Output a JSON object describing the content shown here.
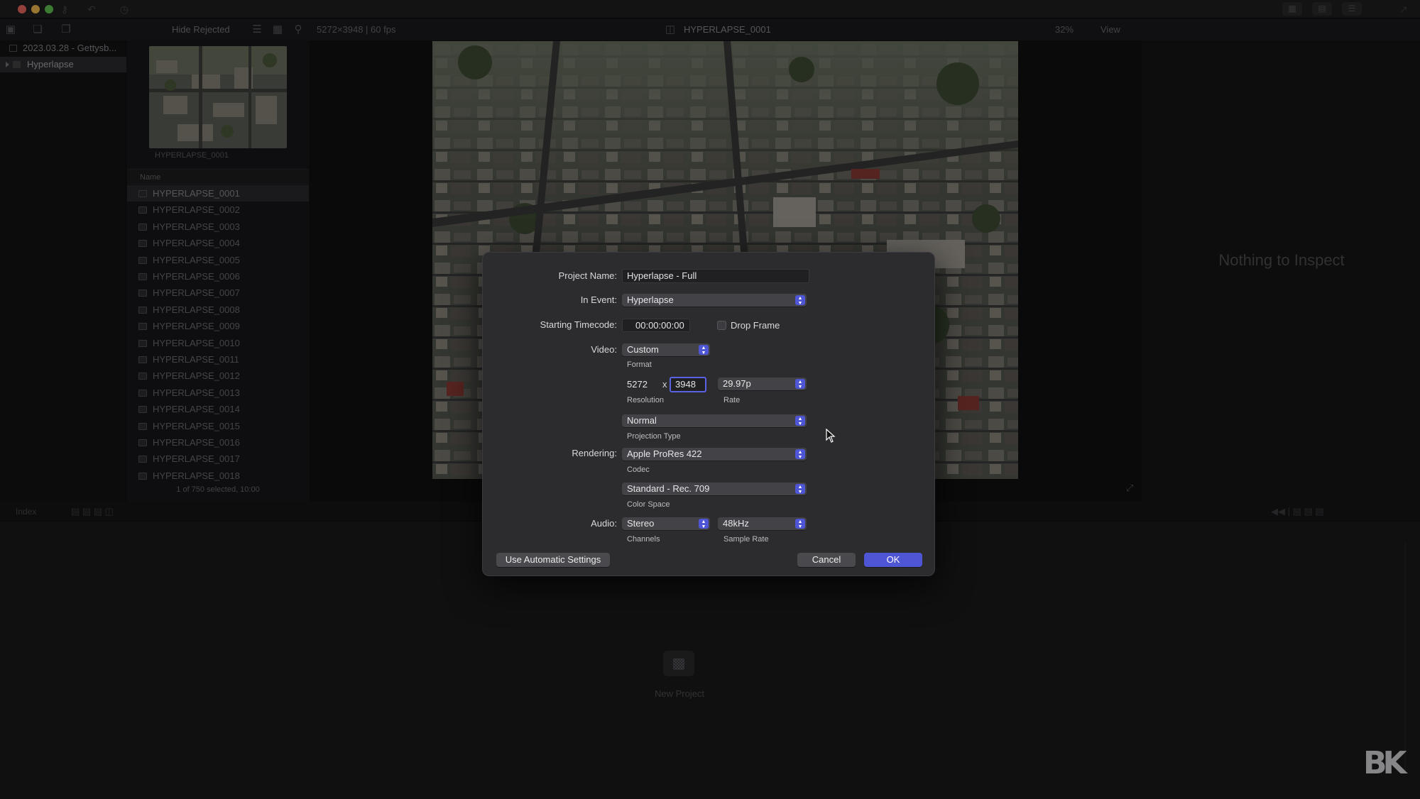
{
  "titlebar": {
    "traffic_lights": {
      "close": "#ed6a5e",
      "minimize": "#f5bf4f",
      "zoom": "#61c554"
    },
    "left_icons": [
      "key-icon",
      "undo-icon",
      "clock-icon"
    ],
    "right_icons": [
      "grid-view-icon",
      "filmstrip-icon",
      "inspector-toggle-icon"
    ]
  },
  "toolbar": {
    "filter_label": "Hide Rejected",
    "clip_info": "5272×3948 | 60 fps",
    "viewer_title": "HYPERLAPSE_0001",
    "zoom": "32%",
    "view_label": "View"
  },
  "library": {
    "event_root": "2023.03.28 - Gettysb...",
    "event_selected": "Hyperlapse"
  },
  "browser": {
    "thumbnail_caption": "HYPERLAPSE_0001",
    "column_name": "Name",
    "clips": [
      "HYPERLAPSE_0001",
      "HYPERLAPSE_0002",
      "HYPERLAPSE_0003",
      "HYPERLAPSE_0004",
      "HYPERLAPSE_0005",
      "HYPERLAPSE_0006",
      "HYPERLAPSE_0007",
      "HYPERLAPSE_0008",
      "HYPERLAPSE_0009",
      "HYPERLAPSE_0010",
      "HYPERLAPSE_0011",
      "HYPERLAPSE_0012",
      "HYPERLAPSE_0013",
      "HYPERLAPSE_0014",
      "HYPERLAPSE_0015",
      "HYPERLAPSE_0016",
      "HYPERLAPSE_0017",
      "HYPERLAPSE_0018"
    ],
    "selected_index": 0,
    "status": "1 of 750 selected, 10:00"
  },
  "inspector": {
    "empty_text": "Nothing to Inspect"
  },
  "timeline": {
    "index_label": "Index",
    "new_project_label": "New Project"
  },
  "watermark": "BK",
  "dialog": {
    "project_name_label": "Project Name:",
    "project_name_value": "Hyperlapse - Full",
    "in_event_label": "In Event:",
    "in_event_value": "Hyperlapse",
    "timecode_label": "Starting Timecode:",
    "timecode_value": "00:00:00:00",
    "drop_frame_label": "Drop Frame",
    "drop_frame_checked": false,
    "video_label": "Video:",
    "format_value": "Custom",
    "format_caption": "Format",
    "res_width": "5272",
    "res_x": "x",
    "res_height": "3948",
    "resolution_caption": "Resolution",
    "rate_value": "29.97p",
    "rate_caption": "Rate",
    "projection_value": "Normal",
    "projection_caption": "Projection Type",
    "rendering_label": "Rendering:",
    "codec_value": "Apple ProRes 422",
    "codec_caption": "Codec",
    "colorspace_value": "Standard - Rec. 709",
    "colorspace_caption": "Color Space",
    "audio_label": "Audio:",
    "channels_value": "Stereo",
    "channels_caption": "Channels",
    "samplerate_value": "48kHz",
    "samplerate_caption": "Sample Rate",
    "auto_settings_button": "Use Automatic Settings",
    "cancel_button": "Cancel",
    "ok_button": "OK",
    "accent_color": "#4f56d6"
  }
}
